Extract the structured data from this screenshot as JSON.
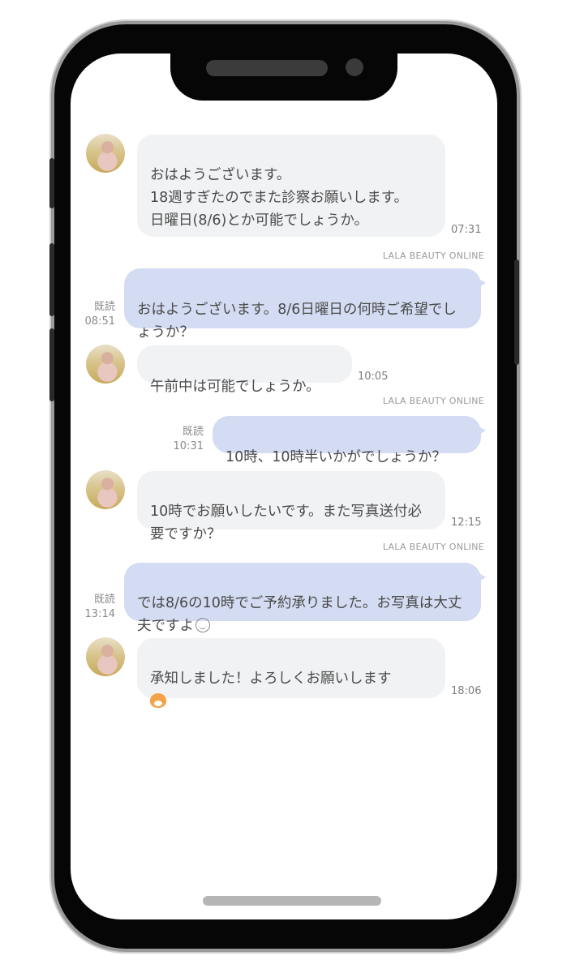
{
  "messages": [
    {
      "dir": "in",
      "text": "おはようございます。\n18週すぎたのでまた診察お願いします。\n日曜日(8/6)とか可能でしょうか。",
      "time": "07:31"
    },
    {
      "dir": "out",
      "sender": "LALA BEAUTY ONLINE",
      "text": "おはようございます。8/6日曜日の何時ご希望でしょうか？",
      "read": "既読",
      "time": "08:51"
    },
    {
      "dir": "in",
      "text": "午前中は可能でしょうか。",
      "time": "10:05"
    },
    {
      "dir": "out",
      "sender": "LALA BEAUTY ONLINE",
      "text": "10時、10時半いかがでしょうか？",
      "read": "既読",
      "time": "10:31"
    },
    {
      "dir": "in",
      "text": "10時でお願いしたいです。また写真送付必要ですか？",
      "time": "12:15"
    },
    {
      "dir": "out",
      "sender": "LALA BEAUTY ONLINE",
      "text": "では8/6の10時でご予約承りました。お写真は大丈夫ですよ",
      "emoji": "smile-emoji",
      "read": "既読",
      "time": "13:14"
    },
    {
      "dir": "in",
      "text": "承知しました！よろしくお願いします",
      "emoji": "cat-emoji",
      "time": "18:06"
    }
  ]
}
